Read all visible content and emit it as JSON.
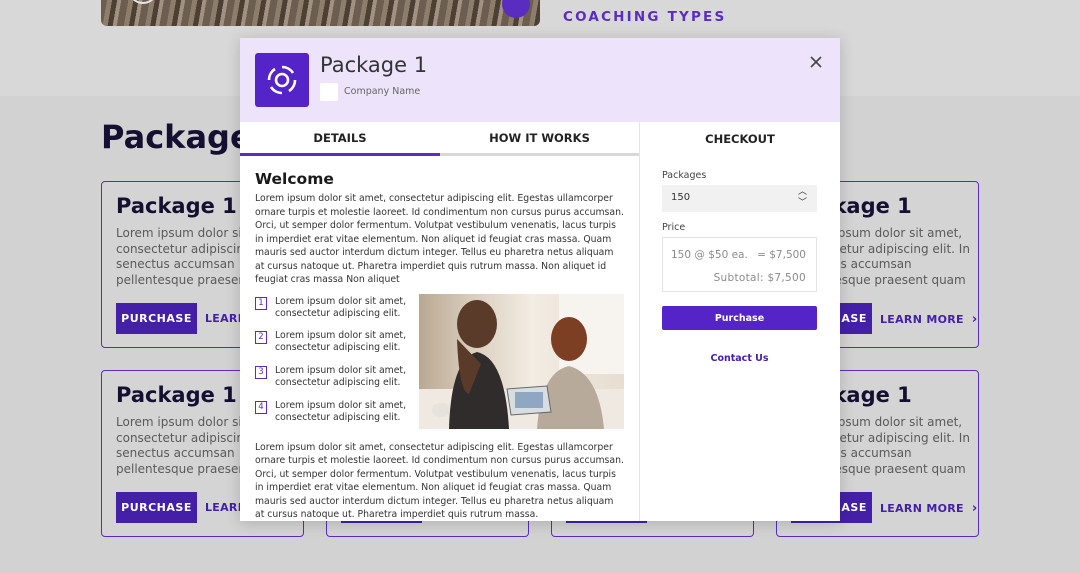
{
  "background": {
    "section_label": "COACHING TYPES",
    "heading": "Packages",
    "cards": [
      {
        "title": "Package 1",
        "text": "Lorem ipsum dolor sit amet, consectetur adipiscing elit. In senectus accumsan pellentesque praesent quam",
        "purchase": "PURCHASE",
        "learn": "LEARN"
      },
      {
        "title": "Package 1",
        "text": "Lorem ipsum dolor sit amet, consectetur adipiscing elit. In senectus accumsan pellentesque praesent quam",
        "purchase": "PURCHASE",
        "learn": "LEARN"
      },
      {
        "title": "Package 1",
        "text": "Lorem ipsum dolor sit amet, consectetur adipiscing elit. In senectus accumsan pellentesque praesent quam",
        "purchase": "PURCHASE",
        "learn": "LEARN MORE"
      },
      {
        "title": "Package 1",
        "text": "Lorem ipsum dolor sit amet, consectetur adipiscing elit. In senectus accumsan pellentesque praesent quam",
        "purchase": "PURCHASE",
        "learn": "LEARN MORE"
      }
    ]
  },
  "modal": {
    "title": "Package 1",
    "company_name": "Company Name",
    "tabs": {
      "details": "DETAILS",
      "how": "HOW IT WORKS"
    },
    "welcome": "Welcome",
    "paragraph1": "Lorem ipsum dolor sit amet, consectetur adipiscing elit. Egestas ullamcorper ornare turpis et molestie laoreet. Id condimentum non cursus purus accumsan. Orci, ut semper dolor fermentum. Volutpat vestibulum venenatis, lacus turpis in imperdiet erat vitae elementum. Non aliquet id feugiat cras massa. Quam mauris sed auctor interdum dictum integer. Tellus eu pharetra netus aliquam at cursus natoque ut. Pharetra imperdiet quis rutrum massa. Non aliquet id feugiat cras massa Non aliquet",
    "list": [
      {
        "num": "1",
        "text": "Lorem ipsum dolor sit amet, consectetur adipiscing elit."
      },
      {
        "num": "2",
        "text": "Lorem ipsum dolor sit amet, consectetur adipiscing elit."
      },
      {
        "num": "3",
        "text": "Lorem ipsum dolor sit amet, consectetur adipiscing elit."
      },
      {
        "num": "4",
        "text": "Lorem ipsum dolor sit amet, consectetur adipiscing elit."
      }
    ],
    "paragraph2": "Lorem ipsum dolor sit amet, consectetur adipiscing elit. Egestas ullamcorper ornare turpis et molestie laoreet. Id condimentum non cursus purus accumsan. Orci, ut semper dolor fermentum. Volutpat vestibulum venenatis, lacus turpis in imperdiet erat vitae elementum. Non aliquet id feugiat cras massa. Quam mauris sed auctor interdum dictum integer. Tellus eu pharetra netus aliquam at cursus natoque ut. Pharetra imperdiet quis rutrum massa.",
    "checkout": {
      "title": "CHECKOUT",
      "packages_label": "Packages",
      "packages_value": "150",
      "price_label": "Price",
      "price_calc": "150 @ $50 ea.",
      "price_total": "= $7,500",
      "subtotal": "Subtotal: $7,500",
      "purchase": "Purchase",
      "contact": "Contact Us"
    }
  },
  "colors": {
    "accent": "#5424c9",
    "dark_accent": "#4420a8",
    "header_tint": "#ede4fb"
  }
}
